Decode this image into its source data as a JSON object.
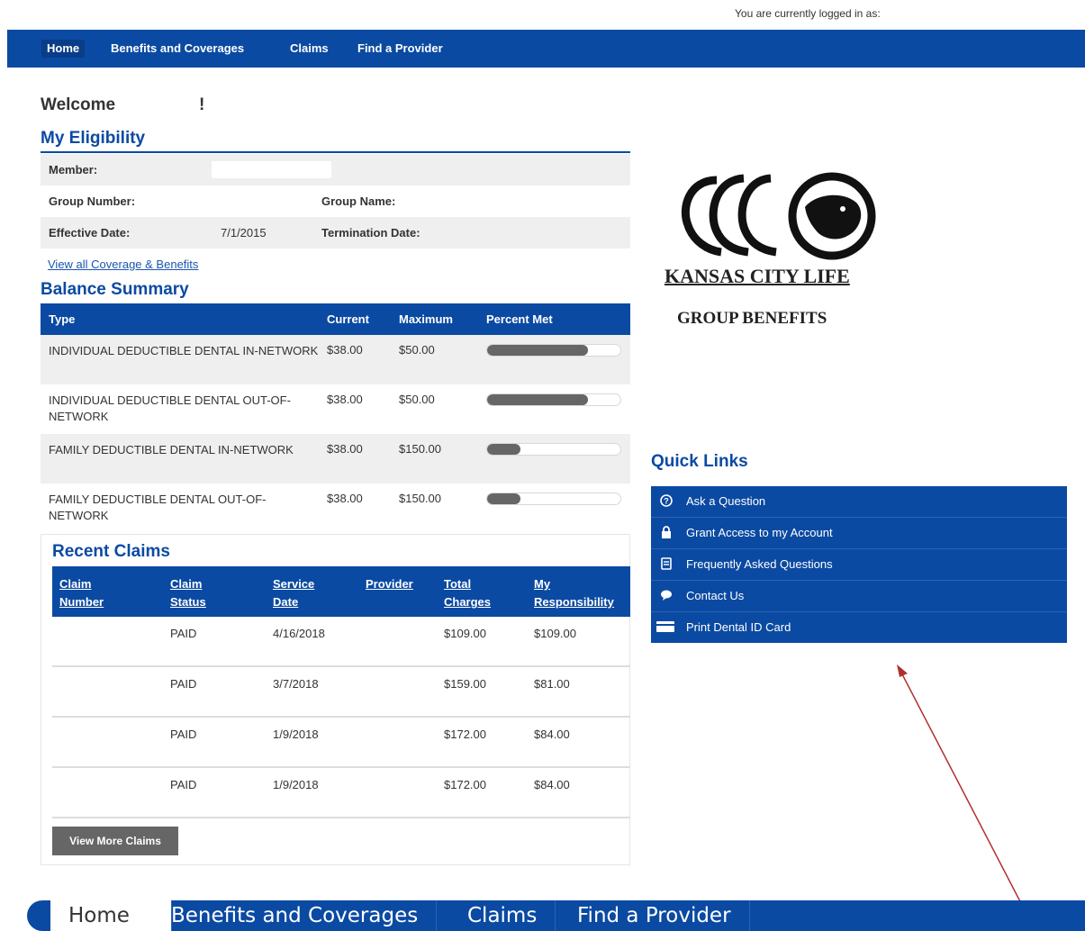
{
  "header": {
    "login_text": "You are currently logged in as:"
  },
  "nav": {
    "items": [
      "Home",
      "Benefits and Coverages",
      "Claims",
      "Find a Provider"
    ]
  },
  "welcome": {
    "text": "Welcome",
    "suffix": "!"
  },
  "eligibility": {
    "title": "My Eligibility",
    "member_label": "Member:",
    "group_number_label": "Group Number:",
    "group_name_label": "Group Name:",
    "effective_date_label": "Effective Date:",
    "effective_date_value": "7/1/2015",
    "termination_date_label": "Termination Date:",
    "view_all_link": "View all Coverage & Benefits"
  },
  "balance": {
    "title": "Balance Summary",
    "columns": [
      "Type",
      "Current",
      "Maximum",
      "Percent Met"
    ],
    "rows": [
      {
        "type": "INDIVIDUAL DEDUCTIBLE DENTAL IN-NETWORK",
        "current": "$38.00",
        "maximum": "$50.00",
        "percent": 76
      },
      {
        "type": "INDIVIDUAL DEDUCTIBLE DENTAL OUT-OF-NETWORK",
        "current": "$38.00",
        "maximum": "$50.00",
        "percent": 76
      },
      {
        "type": "FAMILY DEDUCTIBLE DENTAL IN-NETWORK",
        "current": "$38.00",
        "maximum": "$150.00",
        "percent": 25
      },
      {
        "type": "FAMILY DEDUCTIBLE DENTAL OUT-OF-NETWORK",
        "current": "$38.00",
        "maximum": "$150.00",
        "percent": 25
      }
    ]
  },
  "claims": {
    "title": "Recent Claims",
    "columns": [
      {
        "l1": "Claim",
        "l2": "Number"
      },
      {
        "l1": "Claim",
        "l2": "Status"
      },
      {
        "l1": "Service",
        "l2": "Date"
      },
      {
        "l1": "Provider",
        "l2": ""
      },
      {
        "l1": "Total",
        "l2": "Charges"
      },
      {
        "l1": "My",
        "l2": "Responsibility"
      }
    ],
    "rows": [
      {
        "status": "PAID",
        "date": "4/16/2018",
        "total": "$109.00",
        "resp": "$109.00"
      },
      {
        "status": "PAID",
        "date": "3/7/2018",
        "total": "$159.00",
        "resp": "$81.00"
      },
      {
        "status": "PAID",
        "date": "1/9/2018",
        "total": "$172.00",
        "resp": "$84.00"
      },
      {
        "status": "PAID",
        "date": "1/9/2018",
        "total": "$172.00",
        "resp": "$84.00"
      }
    ],
    "view_more_button": "View More Claims"
  },
  "logo": {
    "brand": "KANSAS CITY LIFE",
    "sub": "GROUP BENEFITS"
  },
  "quick_links": {
    "title": "Quick Links",
    "items": [
      {
        "label": "Ask a Question",
        "icon": "question-icon"
      },
      {
        "label": "Grant Access to my Account",
        "icon": "lock-icon"
      },
      {
        "label": "Frequently Asked Questions",
        "icon": "faq-icon"
      },
      {
        "label": "Contact Us",
        "icon": "chat-icon"
      },
      {
        "label": "Print Dental ID Card",
        "icon": "card-icon"
      }
    ]
  },
  "colors": {
    "primary": "#0b4aa2",
    "annotation_arrow": "#b03030"
  }
}
